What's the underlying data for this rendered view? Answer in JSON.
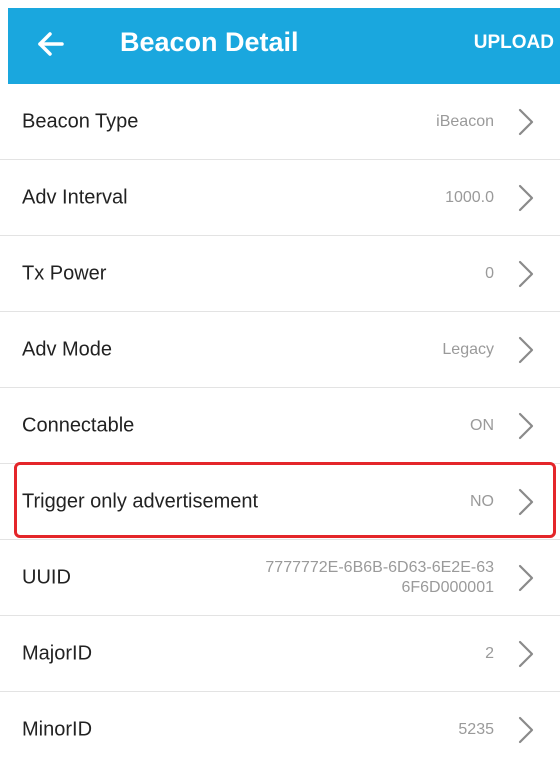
{
  "header": {
    "title": "Beacon Detail",
    "action_label": "UPLOAD",
    "back_icon": "arrow-left-icon"
  },
  "colors": {
    "header_bg": "#1aa7de",
    "highlight_border": "#e4262a",
    "value_text": "#9a9a9a"
  },
  "rows": [
    {
      "label": "Beacon Type",
      "value": "iBeacon"
    },
    {
      "label": "Adv Interval",
      "value": "1000.0"
    },
    {
      "label": "Tx Power",
      "value": "0"
    },
    {
      "label": "Adv Mode",
      "value": "Legacy"
    },
    {
      "label": "Connectable",
      "value": "ON"
    },
    {
      "label": "Trigger only advertisement",
      "value": "NO"
    },
    {
      "label": "UUID",
      "value": "7777772E-6B6B-6D63-6E2E-63\n6F6D000001"
    },
    {
      "label": "MajorID",
      "value": "2"
    },
    {
      "label": "MinorID",
      "value": "5235"
    }
  ],
  "row_icon": "chevron-right-icon"
}
